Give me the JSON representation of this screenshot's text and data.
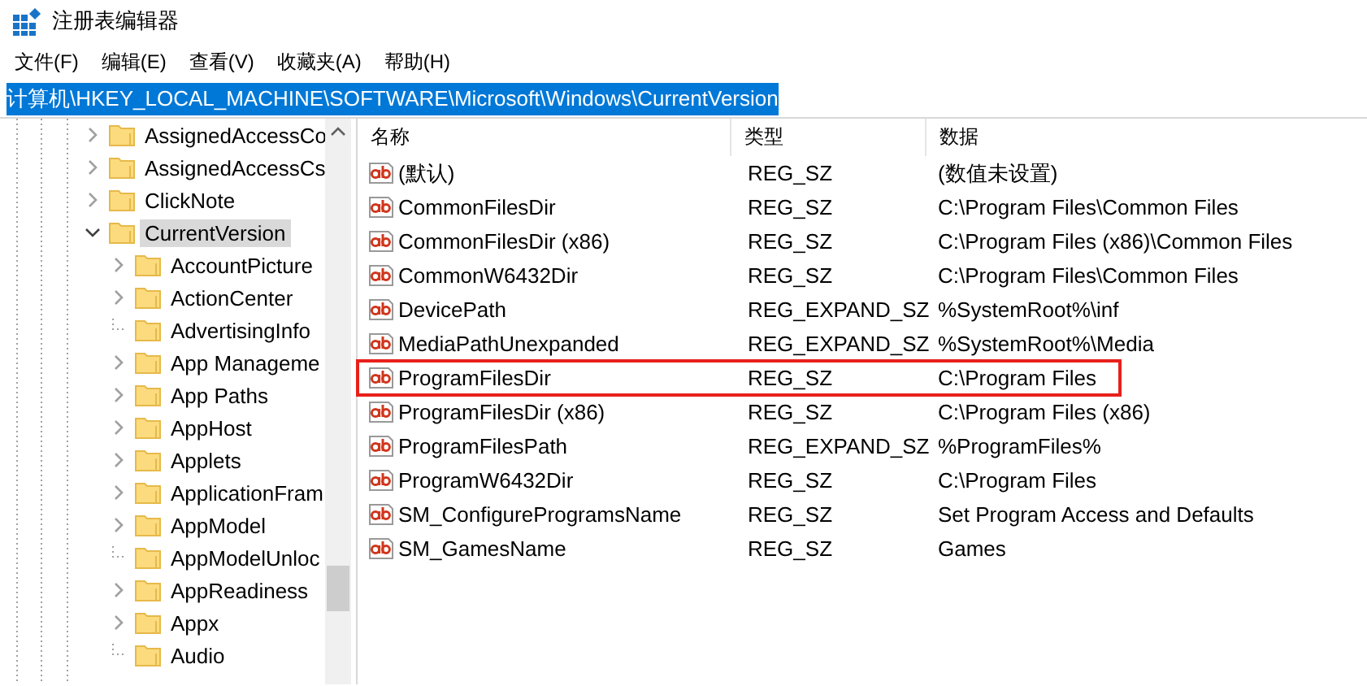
{
  "window": {
    "title": "注册表编辑器"
  },
  "menu": [
    "文件(F)",
    "编辑(E)",
    "查看(V)",
    "收藏夹(A)",
    "帮助(H)"
  ],
  "address": {
    "value": "计算机\\HKEY_LOCAL_MACHINE\\SOFTWARE\\Microsoft\\Windows\\CurrentVersion",
    "selected": true
  },
  "tree": [
    {
      "label": "AssignedAccessCo",
      "has_children": true,
      "expanded": false,
      "selected": false
    },
    {
      "label": "AssignedAccessCs",
      "has_children": true,
      "expanded": false,
      "selected": false
    },
    {
      "label": "ClickNote",
      "has_children": true,
      "expanded": false,
      "selected": false
    },
    {
      "label": "CurrentVersion",
      "has_children": true,
      "expanded": true,
      "selected": true,
      "children": [
        {
          "label": "AccountPicture",
          "has_children": true,
          "expanded": false,
          "selected": false
        },
        {
          "label": "ActionCenter",
          "has_children": true,
          "expanded": false,
          "selected": false
        },
        {
          "label": "AdvertisingInfo",
          "has_children": false,
          "selected": false
        },
        {
          "label": "App Manageme",
          "has_children": true,
          "expanded": false,
          "selected": false
        },
        {
          "label": "App Paths",
          "has_children": true,
          "expanded": false,
          "selected": false
        },
        {
          "label": "AppHost",
          "has_children": true,
          "expanded": false,
          "selected": false
        },
        {
          "label": "Applets",
          "has_children": true,
          "expanded": false,
          "selected": false
        },
        {
          "label": "ApplicationFram",
          "has_children": true,
          "expanded": false,
          "selected": false
        },
        {
          "label": "AppModel",
          "has_children": true,
          "expanded": false,
          "selected": false
        },
        {
          "label": "AppModelUnloc",
          "has_children": false,
          "selected": false
        },
        {
          "label": "AppReadiness",
          "has_children": true,
          "expanded": false,
          "selected": false
        },
        {
          "label": "Appx",
          "has_children": true,
          "expanded": false,
          "selected": false
        },
        {
          "label": "Audio",
          "has_children": false,
          "selected": false
        }
      ]
    }
  ],
  "table": {
    "columns": [
      "名称",
      "类型",
      "数据"
    ],
    "rows": [
      {
        "name": "(默认)",
        "type": "REG_SZ",
        "data": "(数值未设置)",
        "highlighted": false
      },
      {
        "name": "CommonFilesDir",
        "type": "REG_SZ",
        "data": "C:\\Program Files\\Common Files",
        "highlighted": false
      },
      {
        "name": "CommonFilesDir (x86)",
        "type": "REG_SZ",
        "data": "C:\\Program Files (x86)\\Common Files",
        "highlighted": false
      },
      {
        "name": "CommonW6432Dir",
        "type": "REG_SZ",
        "data": "C:\\Program Files\\Common Files",
        "highlighted": false
      },
      {
        "name": "DevicePath",
        "type": "REG_EXPAND_SZ",
        "data": "%SystemRoot%\\inf",
        "highlighted": false
      },
      {
        "name": "MediaPathUnexpanded",
        "type": "REG_EXPAND_SZ",
        "data": "%SystemRoot%\\Media",
        "highlighted": false
      },
      {
        "name": "ProgramFilesDir",
        "type": "REG_SZ",
        "data": "C:\\Program Files",
        "highlighted": true
      },
      {
        "name": "ProgramFilesDir (x86)",
        "type": "REG_SZ",
        "data": "C:\\Program Files (x86)",
        "highlighted": false
      },
      {
        "name": "ProgramFilesPath",
        "type": "REG_EXPAND_SZ",
        "data": "%ProgramFiles%",
        "highlighted": false
      },
      {
        "name": "ProgramW6432Dir",
        "type": "REG_SZ",
        "data": "C:\\Program Files",
        "highlighted": false
      },
      {
        "name": "SM_ConfigureProgramsName",
        "type": "REG_SZ",
        "data": "Set Program Access and Defaults",
        "highlighted": false
      },
      {
        "name": "SM_GamesName",
        "type": "REG_SZ",
        "data": "Games",
        "highlighted": false
      }
    ]
  }
}
